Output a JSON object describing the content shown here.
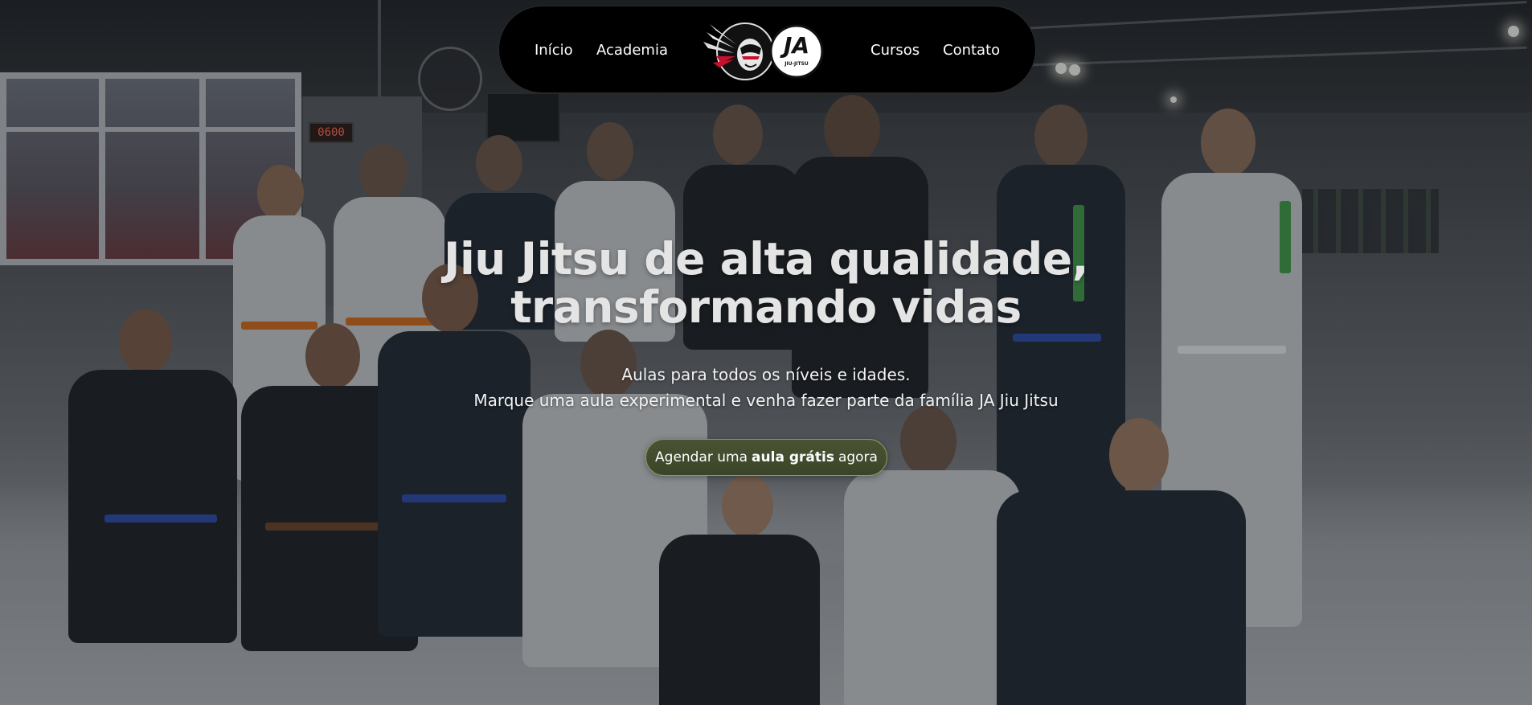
{
  "nav": {
    "links_left": [
      "Início",
      "Academia"
    ],
    "links_right": [
      "Cursos",
      "Contato"
    ],
    "logo": {
      "left_mark_icon": "indian-head-mascot-icon",
      "right_mark_text": "JA",
      "right_mark_subtext": "JIU-JITSU"
    }
  },
  "hero": {
    "title_line1": "Jiu Jitsu de alta qualidade,",
    "title_line2": "transformando vidas",
    "subtitle_line1": "Aulas para todos os níveis e idades.",
    "subtitle_line2": "Marque uma aula experimental e venha fazer parte da família JA Jiu Jitsu",
    "cta": {
      "pre": "Agendar uma",
      "bold": "aula grátis",
      "post": "agora"
    }
  },
  "background": {
    "clock_text": "0600"
  },
  "colors": {
    "nav_bg": "#000000",
    "cta_bg": "#4a5434",
    "cta_border": "#8a9a5a",
    "title_text": "#e4e4e4",
    "logo_accent_red": "#c8102e"
  }
}
